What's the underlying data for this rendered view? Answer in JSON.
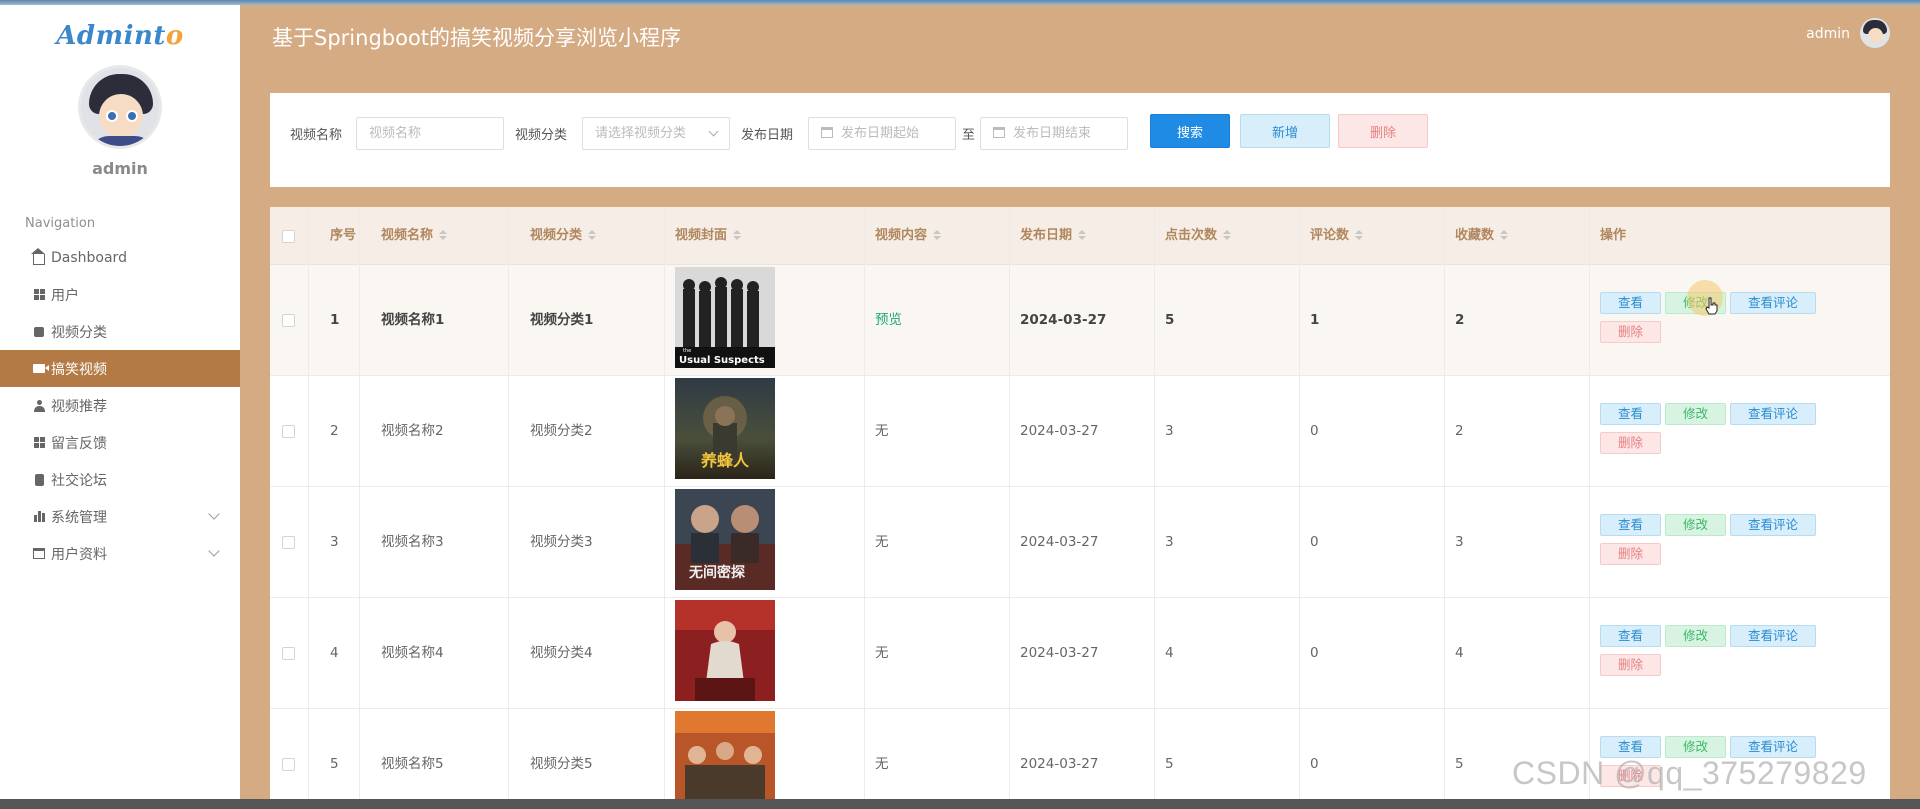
{
  "sidebar": {
    "logo_main": "Admint",
    "logo_accent": "o",
    "username": "admin",
    "nav_title": "Navigation",
    "items": [
      {
        "label": "Dashboard",
        "icon": "home-icon"
      },
      {
        "label": "用户",
        "icon": "grid-icon"
      },
      {
        "label": "视频分类",
        "icon": "square-icon"
      },
      {
        "label": "搞笑视频",
        "icon": "video-icon",
        "active": true
      },
      {
        "label": "视频推荐",
        "icon": "person-icon"
      },
      {
        "label": "留言反馈",
        "icon": "grid-icon"
      },
      {
        "label": "社交论坛",
        "icon": "clipboard-icon"
      },
      {
        "label": "系统管理",
        "icon": "bar-chart-icon",
        "expandable": true
      },
      {
        "label": "用户资料",
        "icon": "calendar-icon",
        "expandable": true
      }
    ]
  },
  "header": {
    "title": "基于Springboot的搞笑视频分享浏览小程序",
    "user": "admin"
  },
  "search": {
    "name_label": "视频名称",
    "name_placeholder": "视频名称",
    "category_label": "视频分类",
    "category_placeholder": "请选择视频分类",
    "date_label": "发布日期",
    "date_start_placeholder": "发布日期起始",
    "date_to": "至",
    "date_end_placeholder": "发布日期结束",
    "search_button": "搜索",
    "add_button": "新增",
    "delete_button": "删除"
  },
  "table": {
    "columns": [
      "序号",
      "视频名称",
      "视频分类",
      "视频封面",
      "视频内容",
      "发布日期",
      "点击次数",
      "评论数",
      "收藏数",
      "操作"
    ],
    "rows": [
      {
        "index": "1",
        "name": "视频名称1",
        "category": "视频分类1",
        "content": "预览",
        "date": "2024-03-27",
        "clicks": "5",
        "comments": "1",
        "favorites": "2"
      },
      {
        "index": "2",
        "name": "视频名称2",
        "category": "视频分类2",
        "content": "无",
        "date": "2024-03-27",
        "clicks": "3",
        "comments": "0",
        "favorites": "2"
      },
      {
        "index": "3",
        "name": "视频名称3",
        "category": "视频分类3",
        "content": "无",
        "date": "2024-03-27",
        "clicks": "3",
        "comments": "0",
        "favorites": "3"
      },
      {
        "index": "4",
        "name": "视频名称4",
        "category": "视频分类4",
        "content": "无",
        "date": "2024-03-27",
        "clicks": "4",
        "comments": "0",
        "favorites": "4"
      },
      {
        "index": "5",
        "name": "视频名称5",
        "category": "视频分类5",
        "content": "无",
        "date": "2024-03-27",
        "clicks": "5",
        "comments": "0",
        "favorites": "5"
      }
    ],
    "actions": {
      "view": "查看",
      "edit": "修改",
      "comments": "查看评论",
      "delete": "删除"
    },
    "poster_1_title_small": "the",
    "poster_1_title": "Usual Suspects",
    "poster_2_title": "养蜂人",
    "poster_3_title": "无间密探"
  },
  "watermark": "CSDN @qq_375279829",
  "colors": {
    "background": "#d5ab83",
    "active_nav": "#b47a45",
    "primary": "#1f8be4",
    "header_text": "#b0875f"
  }
}
